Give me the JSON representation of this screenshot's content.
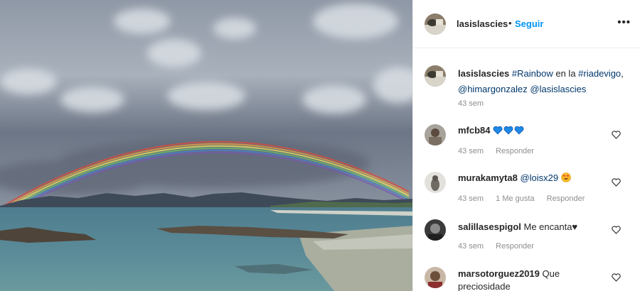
{
  "header": {
    "username": "lasislascies",
    "separator": "•",
    "follow_label": "Seguir",
    "more_label": "•••"
  },
  "caption": {
    "username": "lasislascies",
    "tag1": "#Rainbow",
    "mid_text": " en la ",
    "tag2": "#riadevigo",
    "comma": ",",
    "mention1": "@himargonzalez",
    "mention2": "@lasislascies",
    "time": "43 sem"
  },
  "comments": [
    {
      "username": "mfcb84",
      "text": "",
      "emoji": [
        "blue-heart",
        "blue-heart",
        "blue-heart"
      ],
      "time": "43 sem",
      "likes": "",
      "reply": "Responder"
    },
    {
      "username": "murakamyta8",
      "text": "@loisx29",
      "emoji": [
        "heart-eyes"
      ],
      "time": "43 sem",
      "likes": "1 Me gusta",
      "reply": "Responder"
    },
    {
      "username": "salillasespigol",
      "text": "Me encanta♥",
      "emoji": [],
      "time": "43 sem",
      "likes": "",
      "reply": "Responder"
    },
    {
      "username": "marsotorguez2019",
      "text": "Que",
      "text_line2": "preciosidade",
      "emoji": [],
      "time": "",
      "likes": "",
      "reply": ""
    }
  ],
  "icons": {
    "like": "heart-outline-icon",
    "more": "more-options-icon"
  },
  "colors": {
    "follow": "#0095f6",
    "blue_heart": "#1e88e5",
    "meta": "#8e8e8e"
  }
}
